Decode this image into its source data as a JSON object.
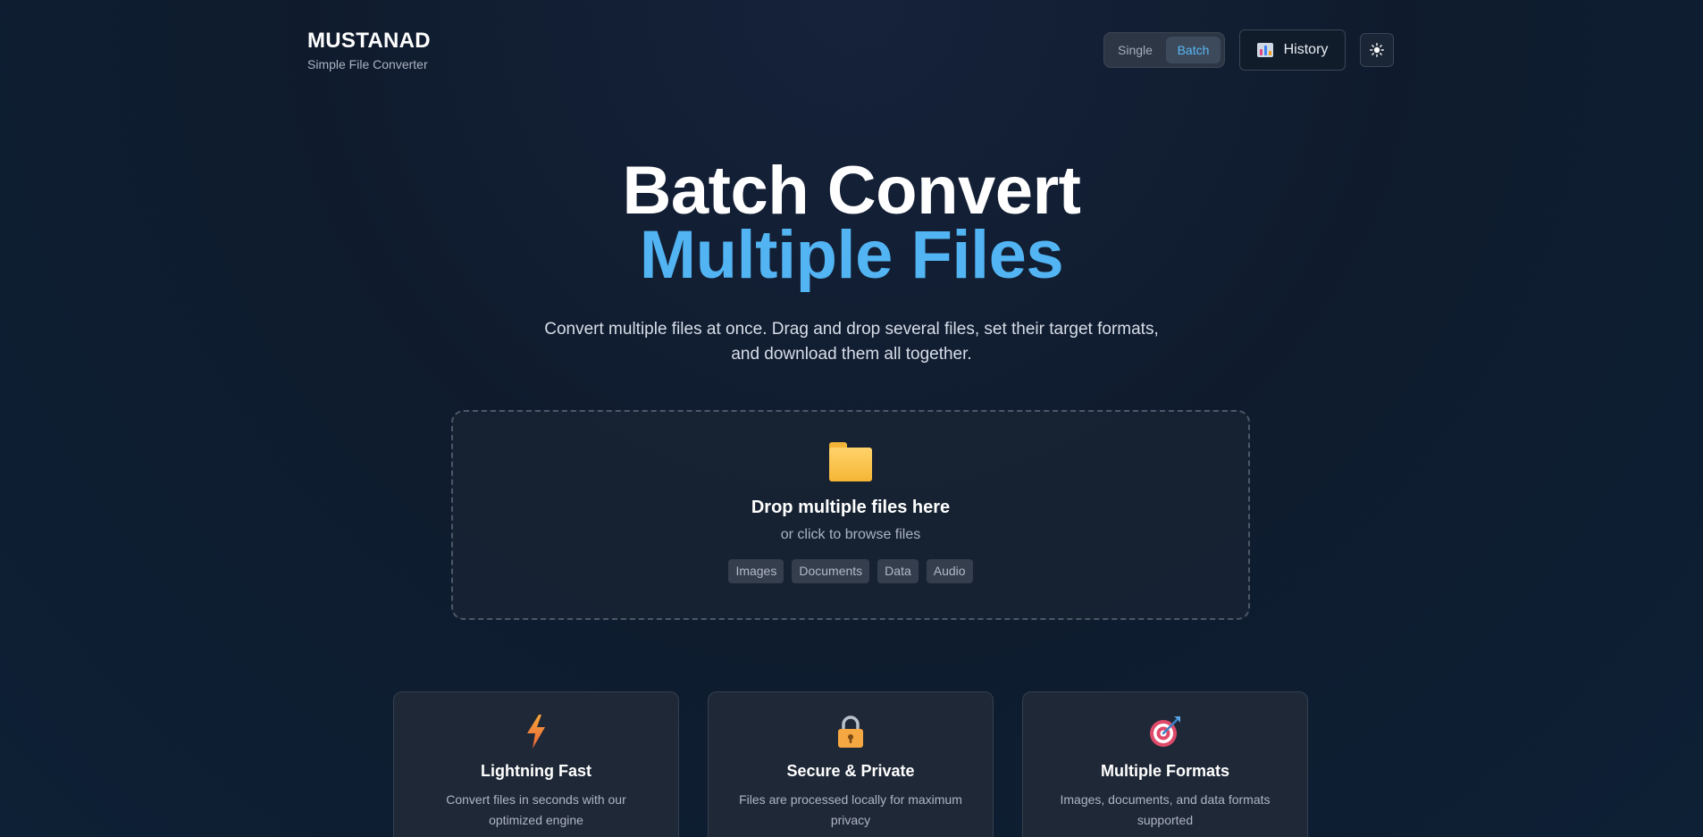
{
  "brand": {
    "name": "MUSTANAD",
    "tagline": "Simple File Converter"
  },
  "header": {
    "mode_toggle": {
      "options": [
        "Single",
        "Batch"
      ],
      "selected": "Batch"
    },
    "history_label": "History",
    "history_icon": "bar-chart-icon",
    "theme_icon": "sun-icon"
  },
  "hero": {
    "title_line1": "Batch Convert",
    "title_line2": "Multiple Files",
    "subtitle": "Convert multiple files at once. Drag and drop several files, set their target formats, and download them all together."
  },
  "dropzone": {
    "icon": "folder-icon",
    "title": "Drop multiple files here",
    "subtitle": "or click to browse files",
    "tags": [
      "Images",
      "Documents",
      "Data",
      "Audio"
    ]
  },
  "features": [
    {
      "icon": "lightning-icon",
      "title": "Lightning Fast",
      "description": "Convert files in seconds with our optimized engine"
    },
    {
      "icon": "lock-icon",
      "title": "Secure & Private",
      "description": "Files are processed locally for maximum privacy"
    },
    {
      "icon": "target-icon",
      "title": "Multiple Formats",
      "description": "Images, documents, and data formats supported"
    }
  ],
  "colors": {
    "accent": "#52b4f3",
    "background": "#0f1a2c",
    "card": "#1f2836"
  }
}
